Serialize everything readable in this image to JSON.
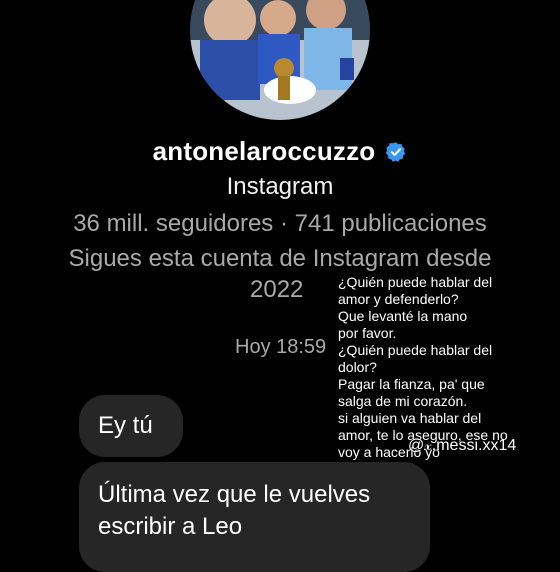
{
  "profile": {
    "username": "antonelaroccuzzo",
    "verified_icon": "verified-badge-icon",
    "platform": "Instagram",
    "stats": "36 mill. seguidores · 741 publicaciones",
    "follow_since_line1": "Sigues esta cuenta de Instagram desde",
    "follow_since_line2": "2022",
    "accent_color": "#3897f0"
  },
  "chat": {
    "timestamp": "Hoy 18:59",
    "messages": [
      {
        "text": "Ey tú"
      },
      {
        "text": "Última vez que le vuelves escribir a Leo"
      }
    ],
    "bubble_color": "#262626"
  },
  "overlay": {
    "lyrics": "¿Quién puede hablar del\n amor y defenderlo?\n   Que levanté la mano\n        por favor.\n¿Quién puede hablar del\n         dolor?\nPagar la fianza, pa' que\n  salga de mi corazón.\nsi alguien va hablar del\namor, te lo aseguro, ese no\nvoy a hacerlo yo",
    "watermark": "@𝓍.messi.xx14"
  }
}
